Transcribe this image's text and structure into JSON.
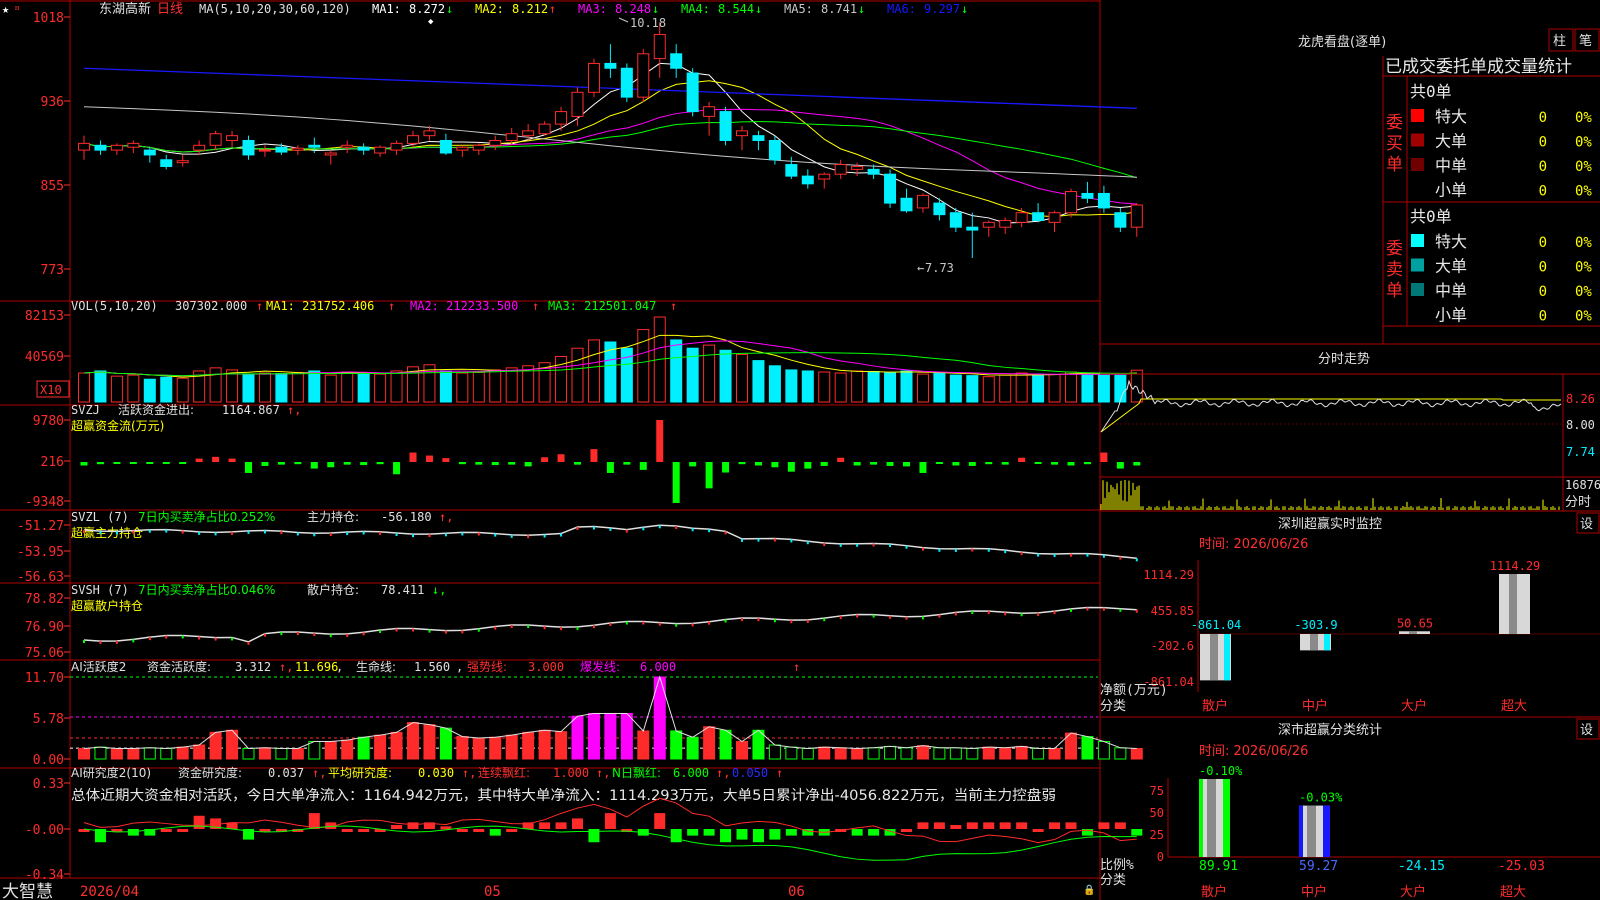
{
  "colors": {
    "up": "#ff2b2b",
    "down": "#00f0ff",
    "grid": "#b00000",
    "text": "#c8c8c8",
    "yellow": "#ffff00",
    "magenta": "#ff00ff",
    "green": "#00ff00",
    "white": "#ffffff",
    "blue": "#1818ff"
  },
  "main": {
    "stock_name": "东湖高新",
    "period": "日线",
    "ma_params": "MA(5,10,20,30,60,120)",
    "ma_values": [
      {
        "label": "MA1:",
        "value": "8.272",
        "arrow": "↓",
        "color": "#ffffff"
      },
      {
        "label": "MA2:",
        "value": "8.212",
        "arrow": "↑",
        "color": "#ffff00"
      },
      {
        "label": "MA3:",
        "value": "8.248",
        "arrow": "↓",
        "color": "#ff00ff"
      },
      {
        "label": "MA4:",
        "value": "8.544",
        "arrow": "↓",
        "color": "#00ff00"
      },
      {
        "label": "MA5:",
        "value": "8.741",
        "arrow": "↓",
        "color": "#c8c8c8"
      },
      {
        "label": "MA6:",
        "value": "9.297",
        "arrow": "↓",
        "color": "#1818ff"
      }
    ],
    "ticks": [
      "1018",
      "936",
      "855",
      "773"
    ],
    "high_label": "10.18",
    "low_label": "7.73"
  },
  "vol": {
    "title": "VOL(5,10,20)",
    "value": "307302.000",
    "ma1": "MA1: 231752.406",
    "ma2": "MA2: 212233.500",
    "ma3": "MA3: 212501.047",
    "ticks": [
      "82153",
      "40569"
    ],
    "unit": "X10"
  },
  "svzj": {
    "title": "SVZJ",
    "label": "活跃资金进出:",
    "value": "1164.867",
    "subtitle": "超赢资金流(万元)",
    "ticks": [
      "9780",
      "216",
      "-9348"
    ]
  },
  "svzl": {
    "title": "SVZL (7)",
    "desc": "7日内买卖净占比0.252%",
    "label": "主力持仓:",
    "value": "-56.180",
    "subtitle": "超赢主力持仓",
    "ticks": [
      "-51.27",
      "-53.95",
      "-56.63"
    ]
  },
  "svsh": {
    "title": "SVSH (7)",
    "desc": "7日内买卖净占比0.046%",
    "label": "散户持仓:",
    "value": "78.411",
    "subtitle": "超赢散户持仓",
    "ticks": [
      "78.82",
      "76.90",
      "75.06"
    ]
  },
  "ai1": {
    "title": "AI活跃度2",
    "l1": "资金活跃度:",
    "v1": "3.312",
    "v2": "11.696",
    "l3": "生命线:",
    "v3": "1.560",
    "l4": "强势线:",
    "v4": "3.000",
    "l5": "爆发线:",
    "v5": "6.000",
    "ticks": [
      "11.70",
      "5.78",
      "0.00"
    ]
  },
  "ai2": {
    "title": "AI研究度2(10)",
    "l1": "资金研究度:",
    "v1": "0.037",
    "l2": "平均研究度:",
    "v2": "0.030",
    "l3": "连续飘红:",
    "v3": "1.000",
    "l4": "N日飘红:",
    "v4": "6.000",
    "v5": "0.050",
    "summary": "总体近期大资金相对活跃，今日大单净流入：1164.942万元，其中特大单净流入：1114.293万元，大单5日累计净出-4056.822万元，当前主力控盘弱",
    "ticks": [
      "0.33",
      "-0.00",
      "-0.34"
    ]
  },
  "bottom": {
    "brand": "大智慧",
    "date": "2026/04",
    "month1": "05",
    "month2": "06"
  },
  "right": {
    "lhb_title": "龙虎看盘(逐单)",
    "btn_bar": "柱",
    "btn_bi": "笔",
    "stats_title": "已成交委托单成交量统计",
    "buy_label": "委买单",
    "sell_label": "委卖单",
    "buy_total": "共0单",
    "sell_total": "共0单",
    "buy_rows": [
      {
        "name": "特大",
        "count": "0",
        "pct": "0%",
        "color": "#ff0000"
      },
      {
        "name": "大单",
        "count": "0",
        "pct": "0%",
        "color": "#a00000"
      },
      {
        "name": "中单",
        "count": "0",
        "pct": "0%",
        "color": "#700000"
      },
      {
        "name": "小单",
        "count": "0",
        "pct": "0%",
        "color": ""
      }
    ],
    "sell_rows": [
      {
        "name": "特大",
        "count": "0",
        "pct": "0%",
        "color": "#00ffff"
      },
      {
        "name": "大单",
        "count": "0",
        "pct": "0%",
        "color": "#00a0a0"
      },
      {
        "name": "中单",
        "count": "0",
        "pct": "0%",
        "color": "#007878"
      },
      {
        "name": "小单",
        "count": "0",
        "pct": "0%",
        "color": ""
      }
    ],
    "fs_title": "分时走势",
    "fs_ticks": [
      "8.26",
      "8.00",
      "7.74"
    ],
    "fs_vol": "16876",
    "fs_unit": "分时",
    "mon_title": "深圳超赢实时监控",
    "mon_btn": "设",
    "mon_date": "时间: 2026/06/26",
    "mon_ticks": [
      "1114.29",
      "455.85",
      "-202.6",
      "-861.04"
    ],
    "mon_ylabel": "净额(万元)",
    "mon_xlabel": "分类",
    "mon_bars": [
      {
        "cat": "散户",
        "value": "-861.04",
        "num": -861.04
      },
      {
        "cat": "中户",
        "value": "-303.9",
        "num": -303.9
      },
      {
        "cat": "大户",
        "value": "50.65",
        "num": 50.65
      },
      {
        "cat": "超大",
        "value": "1114.29",
        "num": 1114.29
      }
    ],
    "cls_title": "深市超赢分类统计",
    "cls_btn": "设",
    "cls_date": "时间: 2026/06/26",
    "cls_ticks": [
      "75",
      "50",
      "25",
      "0"
    ],
    "cls_ylabel": "比例%",
    "cls_xlabel": "分类",
    "cls_bars": [
      {
        "cat": "散户",
        "top": "-0.10%",
        "bottom": "89.91",
        "num": 89.91
      },
      {
        "cat": "中户",
        "top": "-0.03%",
        "bottom": "59.27",
        "num": 59.27
      },
      {
        "cat": "大户",
        "top": "",
        "bottom": "-24.15",
        "num": 0
      },
      {
        "cat": "超大",
        "top": "",
        "bottom": "-25.03",
        "num": 0
      }
    ]
  },
  "chart_data": [
    {
      "type": "candlestick",
      "title": "东湖高新 日线",
      "y_unit": "元",
      "ylim": [
        7.73,
        10.18
      ],
      "x": [
        "2026/04",
        "05",
        "06"
      ],
      "ohlc": [
        [
          8.85,
          9.0,
          8.75,
          8.92
        ],
        [
          8.9,
          8.95,
          8.8,
          8.85
        ],
        [
          8.85,
          8.92,
          8.8,
          8.9
        ],
        [
          8.88,
          8.95,
          8.82,
          8.92
        ],
        [
          8.85,
          8.88,
          8.72,
          8.8
        ],
        [
          8.75,
          8.8,
          8.65,
          8.68
        ],
        [
          8.72,
          8.8,
          8.68,
          8.74
        ],
        [
          8.85,
          8.95,
          8.8,
          8.9
        ],
        [
          8.9,
          9.05,
          8.85,
          9.02
        ],
        [
          8.95,
          9.05,
          8.88,
          9.0
        ],
        [
          8.95,
          9.0,
          8.75,
          8.8
        ],
        [
          8.85,
          8.9,
          8.78,
          8.85
        ],
        [
          8.88,
          8.92,
          8.8,
          8.83
        ],
        [
          8.85,
          8.9,
          8.8,
          8.87
        ],
        [
          8.9,
          8.98,
          8.82,
          8.88
        ],
        [
          8.8,
          8.85,
          8.7,
          8.82
        ],
        [
          8.88,
          8.95,
          8.82,
          8.9
        ],
        [
          8.88,
          8.92,
          8.8,
          8.85
        ],
        [
          8.82,
          8.9,
          8.78,
          8.88
        ],
        [
          8.85,
          8.95,
          8.8,
          8.92
        ],
        [
          8.92,
          9.05,
          8.88,
          9.0
        ],
        [
          9.0,
          9.1,
          8.95,
          9.05
        ],
        [
          8.95,
          9.02,
          8.8,
          8.82
        ],
        [
          8.85,
          8.9,
          8.78,
          8.88
        ],
        [
          8.85,
          8.92,
          8.8,
          8.9
        ],
        [
          8.9,
          9.0,
          8.85,
          8.95
        ],
        [
          8.95,
          9.08,
          8.9,
          9.02
        ],
        [
          9.0,
          9.12,
          8.95,
          9.05
        ],
        [
          9.02,
          9.15,
          9.0,
          9.12
        ],
        [
          9.12,
          9.3,
          9.05,
          9.25
        ],
        [
          9.2,
          9.5,
          9.1,
          9.45
        ],
        [
          9.45,
          9.8,
          9.4,
          9.75
        ],
        [
          9.75,
          9.95,
          9.6,
          9.7
        ],
        [
          9.7,
          9.75,
          9.35,
          9.4
        ],
        [
          9.4,
          9.9,
          9.35,
          9.85
        ],
        [
          9.8,
          10.18,
          9.6,
          10.05
        ],
        [
          9.85,
          9.95,
          9.6,
          9.7
        ],
        [
          9.65,
          9.7,
          9.2,
          9.25
        ],
        [
          9.2,
          9.35,
          9.0,
          9.3
        ],
        [
          9.25,
          9.3,
          8.9,
          8.95
        ],
        [
          9.0,
          9.1,
          8.85,
          9.05
        ],
        [
          9.0,
          9.05,
          8.85,
          8.95
        ],
        [
          8.95,
          9.0,
          8.7,
          8.75
        ],
        [
          8.7,
          8.78,
          8.55,
          8.58
        ],
        [
          8.58,
          8.65,
          8.45,
          8.5
        ],
        [
          8.55,
          8.62,
          8.45,
          8.6
        ],
        [
          8.6,
          8.75,
          8.55,
          8.7
        ],
        [
          8.65,
          8.72,
          8.58,
          8.68
        ],
        [
          8.65,
          8.7,
          8.55,
          8.6
        ],
        [
          8.6,
          8.65,
          8.25,
          8.3
        ],
        [
          8.35,
          8.45,
          8.2,
          8.22
        ],
        [
          8.25,
          8.4,
          8.2,
          8.38
        ],
        [
          8.3,
          8.35,
          8.12,
          8.18
        ],
        [
          8.2,
          8.25,
          8.0,
          8.05
        ],
        [
          8.05,
          8.2,
          7.73,
          8.02
        ],
        [
          8.05,
          8.12,
          7.95,
          8.1
        ],
        [
          8.05,
          8.15,
          7.98,
          8.12
        ],
        [
          8.1,
          8.25,
          8.05,
          8.2
        ],
        [
          8.2,
          8.3,
          8.1,
          8.12
        ],
        [
          8.1,
          8.22,
          8.0,
          8.2
        ],
        [
          8.2,
          8.45,
          8.15,
          8.42
        ],
        [
          8.4,
          8.52,
          8.3,
          8.35
        ],
        [
          8.4,
          8.48,
          8.2,
          8.25
        ],
        [
          8.2,
          8.25,
          8.0,
          8.05
        ],
        [
          8.05,
          8.3,
          7.95,
          8.28
        ]
      ],
      "series": [
        {
          "name": "MA1",
          "last": 8.272
        },
        {
          "name": "MA2",
          "last": 8.212
        },
        {
          "name": "MA3",
          "last": 8.248
        },
        {
          "name": "MA4",
          "last": 8.544
        },
        {
          "name": "MA5",
          "last": 8.741
        },
        {
          "name": "MA6",
          "last": 9.297
        }
      ]
    },
    {
      "type": "bar",
      "title": "VOL(5,10,20)",
      "ylim": [
        0,
        82153
      ],
      "values": [
        28000,
        30000,
        25000,
        26000,
        22000,
        24000,
        23000,
        30000,
        33000,
        31000,
        27000,
        28000,
        27500,
        28500,
        30000,
        26000,
        29000,
        28000,
        27000,
        30000,
        34000,
        36000,
        30000,
        28000,
        28500,
        31000,
        33000,
        35000,
        38000,
        44000,
        52000,
        60000,
        58000,
        52000,
        70000,
        82153,
        60000,
        52000,
        55000,
        50000,
        46000,
        40000,
        35000,
        31000,
        30000,
        29000,
        28000,
        30000,
        29500,
        28000,
        30000,
        27000,
        28000,
        26000,
        25500,
        24500,
        26000,
        28000,
        27000,
        26500,
        29000,
        28000,
        26500,
        26000,
        30730
      ]
    },
    {
      "type": "bar",
      "title": "SVZJ 超赢资金流(万元)",
      "ylim": [
        -9348,
        9780
      ],
      "values": [
        -800,
        -500,
        -300,
        -400,
        -200,
        -300,
        -300,
        800,
        1200,
        800,
        -2500,
        -900,
        -600,
        -500,
        -1500,
        -1200,
        -600,
        -700,
        -500,
        -2800,
        2200,
        1500,
        900,
        -500,
        -600,
        -700,
        -600,
        -1000,
        1100,
        1800,
        -600,
        3000,
        -2500,
        -600,
        -1800,
        9780,
        -9348,
        -1000,
        -6000,
        -2400,
        -500,
        -800,
        -1200,
        -2200,
        -1500,
        -900,
        1000,
        -800,
        -600,
        -900,
        -1000,
        -2500,
        -300,
        -800,
        -900,
        -500,
        -600,
        1000,
        -300,
        -600,
        -800,
        -500,
        2200,
        -1500,
        -800,
        1165
      ]
    },
    {
      "type": "line",
      "title": "SVZL 主力持仓",
      "ylim": [
        -56.63,
        -51.27
      ]
    },
    {
      "type": "line",
      "title": "SVSH 散户持仓",
      "ylim": [
        75.06,
        78.82
      ]
    },
    {
      "type": "bar",
      "title": "AI活跃度2 资金活跃度",
      "ylim": [
        0,
        11.7
      ],
      "values": [
        1.5,
        1.7,
        1.5,
        1.5,
        1.6,
        1.5,
        1.7,
        2.0,
        3.8,
        4.1,
        1.5,
        1.6,
        1.5,
        1.5,
        2.5,
        2.5,
        2.7,
        3.1,
        3.4,
        3.8,
        5.2,
        4.9,
        4.4,
        3.2,
        3.0,
        3.1,
        3.4,
        3.8,
        4.1,
        3.9,
        6.1,
        6.5,
        6.5,
        6.5,
        4.0,
        11.7,
        4.0,
        3.1,
        4.6,
        4.1,
        2.5,
        4.1,
        2.0,
        1.7,
        1.5,
        1.7,
        1.6,
        1.5,
        1.6,
        1.8,
        1.6,
        1.9,
        1.6,
        1.6,
        1.5,
        1.7,
        1.6,
        1.8,
        1.5,
        1.5,
        3.7,
        3.2,
        2.5,
        1.6,
        1.5,
        3.3
      ]
    },
    {
      "type": "bar",
      "title": "AI研究度2(10) 资金研究度",
      "ylim": [
        -0.34,
        0.33
      ],
      "values": [
        0.0,
        -0.1,
        0.0,
        -0.05,
        -0.05,
        0.0,
        0.0,
        0.1,
        0.08,
        0.05,
        -0.08,
        0.0,
        0.0,
        0.0,
        0.12,
        0.05,
        0.0,
        0.0,
        0.0,
        0.03,
        0.05,
        0.05,
        0.02,
        0.0,
        0.0,
        -0.05,
        0.0,
        0.05,
        0.05,
        0.05,
        0.08,
        -0.1,
        0.12,
        0.0,
        -0.05,
        0.12,
        -0.1,
        -0.05,
        -0.05,
        -0.1,
        -0.08,
        -0.1,
        -0.08,
        -0.05,
        -0.05,
        -0.05,
        0.0,
        -0.05,
        -0.05,
        -0.05,
        0.0,
        0.05,
        0.05,
        0.03,
        0.05,
        0.05,
        0.05,
        0.05,
        0.0,
        0.05,
        0.05,
        -0.05,
        0.05,
        0.05,
        -0.05,
        0.037
      ]
    }
  ]
}
